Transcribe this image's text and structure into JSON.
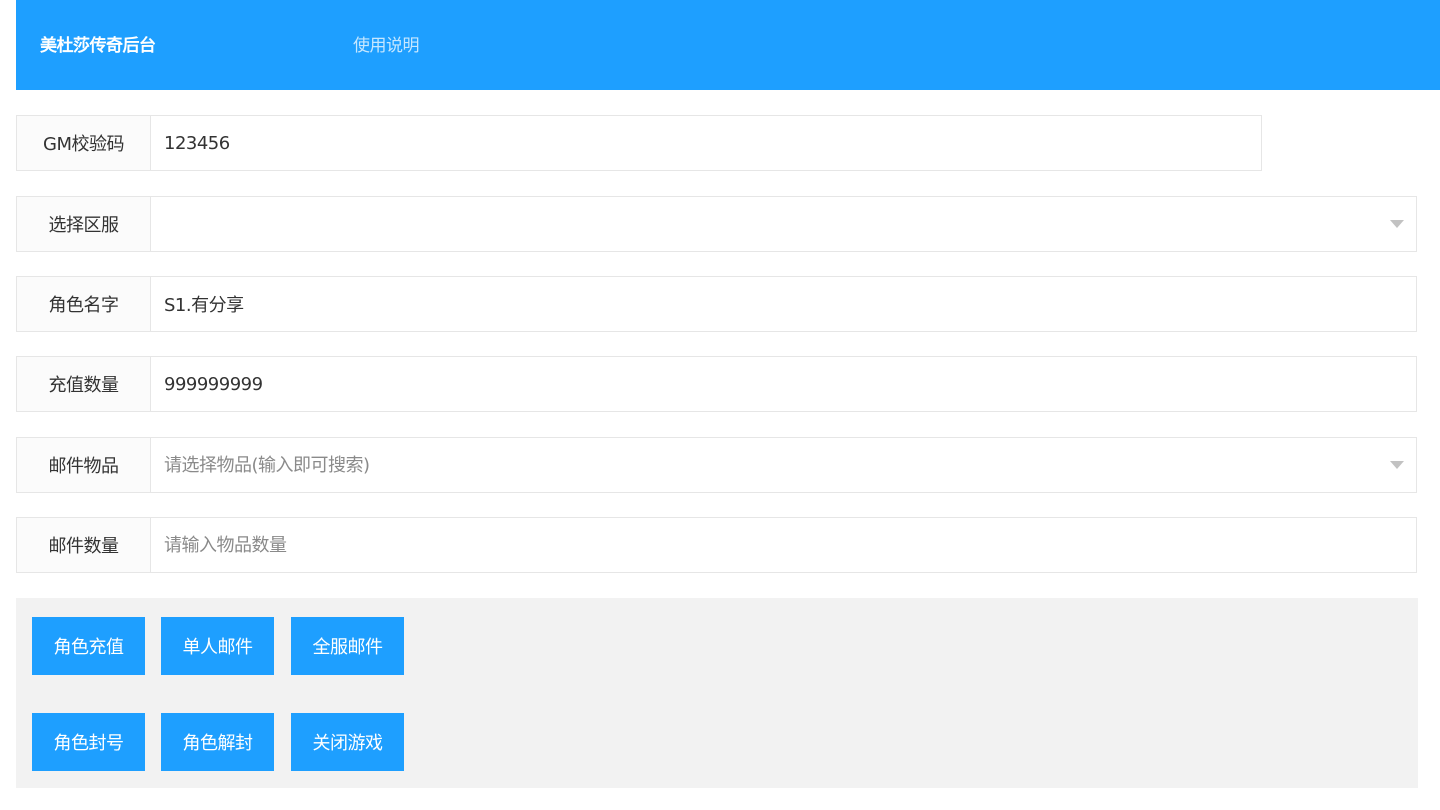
{
  "header": {
    "brand": "美杜莎传奇后台",
    "nav_link": "使用说明",
    "color": "#1e9fff"
  },
  "form": {
    "gm_code": {
      "label": "GM校验码",
      "value": "123456",
      "placeholder": ""
    },
    "server": {
      "label": "选择区服",
      "value": "",
      "placeholder": ""
    },
    "role_name": {
      "label": "角色名字",
      "value": "S1.有分享",
      "placeholder": ""
    },
    "recharge_amount": {
      "label": "充值数量",
      "value": "999999999",
      "placeholder": ""
    },
    "mail_item": {
      "label": "邮件物品",
      "value": "",
      "placeholder": "请选择物品(输入即可搜索)"
    },
    "mail_quantity": {
      "label": "邮件数量",
      "value": "",
      "placeholder": "请输入物品数量"
    }
  },
  "buttons": {
    "role_recharge": "角色充值",
    "single_mail": "单人邮件",
    "server_mail": "全服邮件",
    "ban_role": "角色封号",
    "unban_role": "角色解封",
    "close_game": "关闭游戏"
  },
  "colors": {
    "primary": "#1e9fff",
    "panel_bg": "#f2f2f2",
    "border": "#e6e6e6"
  }
}
